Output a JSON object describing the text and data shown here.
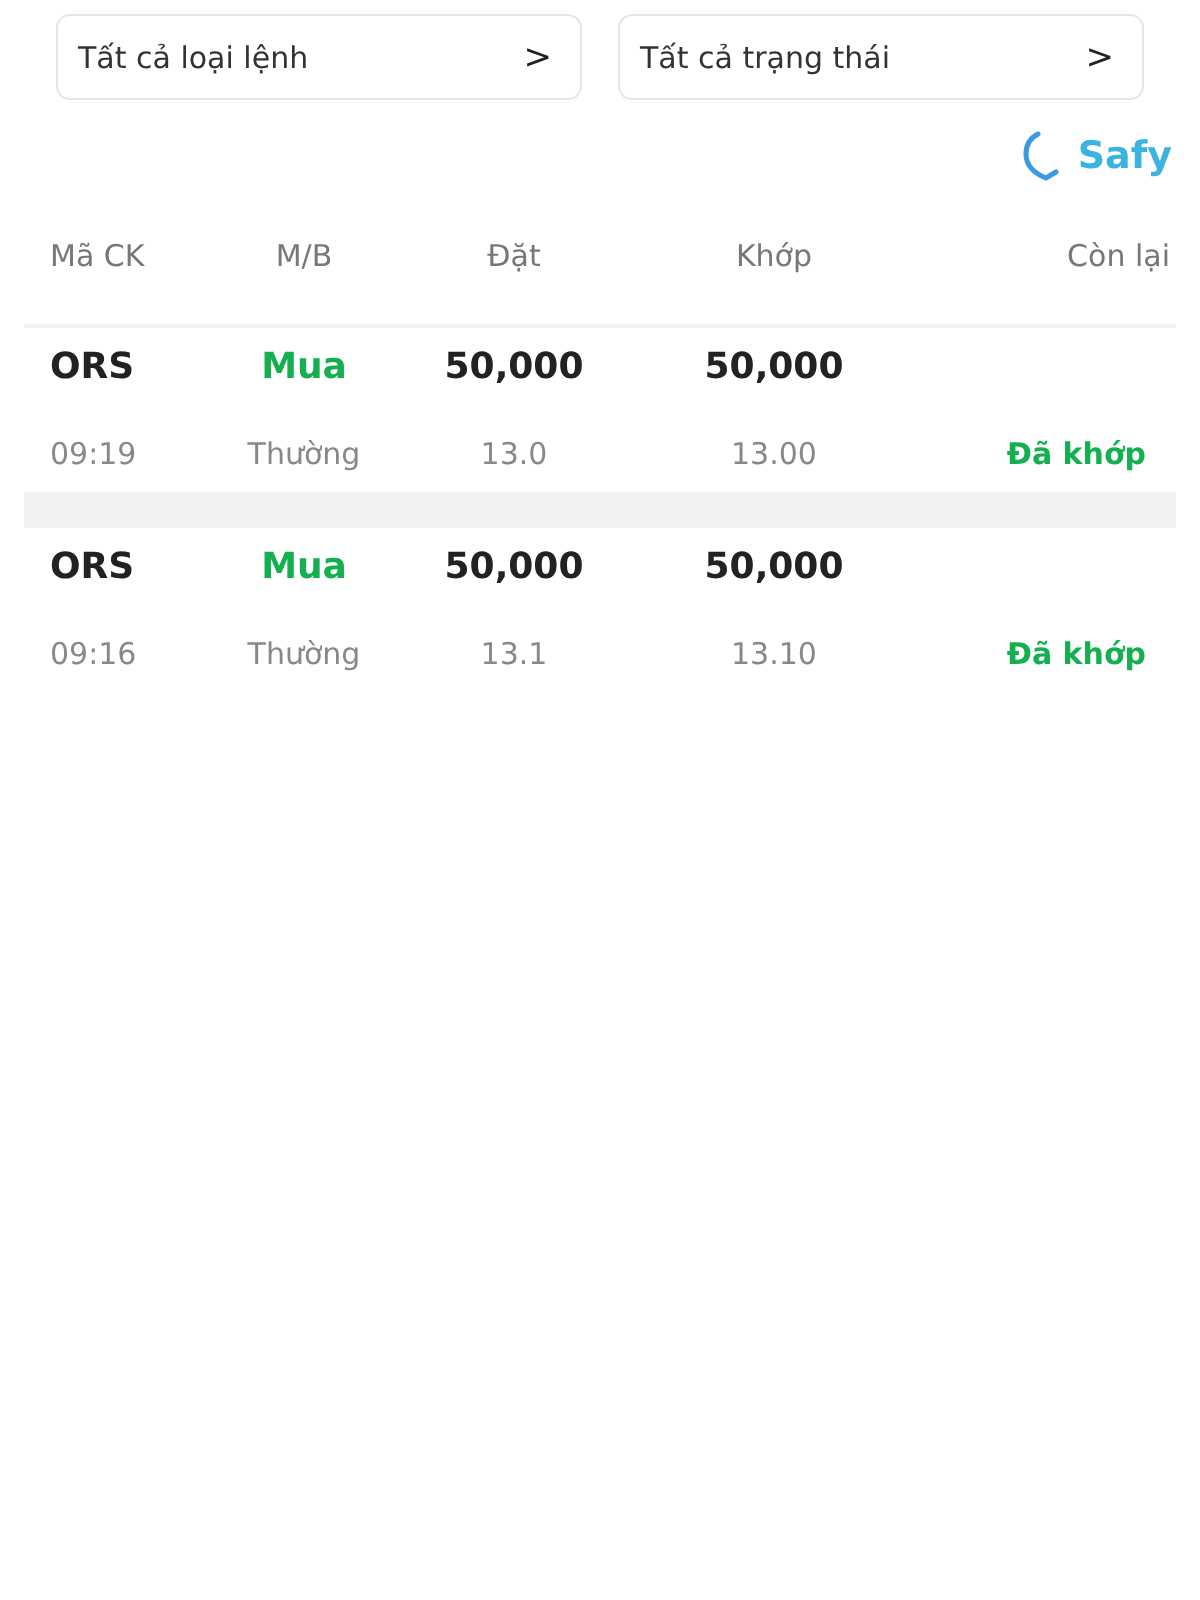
{
  "filters": [
    {
      "label": "Tất cả loại lệnh",
      "chevron": ">"
    },
    {
      "label": "Tất cả trạng thái",
      "chevron": ">"
    }
  ],
  "brand": {
    "name": "Safy"
  },
  "columns": [
    "Mã CK",
    "M/B",
    "Đặt",
    "Khớp",
    "Còn lại"
  ],
  "orders": [
    {
      "symbol": "ORS",
      "time": "09:19",
      "side": {
        "text": "Mua",
        "kind": "buy"
      },
      "order_type": "Thường",
      "placed_qty": "50,000",
      "placed_price": "13.0",
      "matched_qty": "50,000",
      "matched_price": "13.00",
      "status": {
        "text": "Đã khớp",
        "kind": "matched"
      }
    },
    {
      "symbol": "ORS",
      "time": "09:16",
      "side": {
        "text": "Mua",
        "kind": "buy"
      },
      "order_type": "Thường",
      "placed_qty": "50,000",
      "placed_price": "13.1",
      "matched_qty": "50,000",
      "matched_price": "13.10",
      "status": {
        "text": "Đã khớp",
        "kind": "matched"
      }
    }
  ]
}
